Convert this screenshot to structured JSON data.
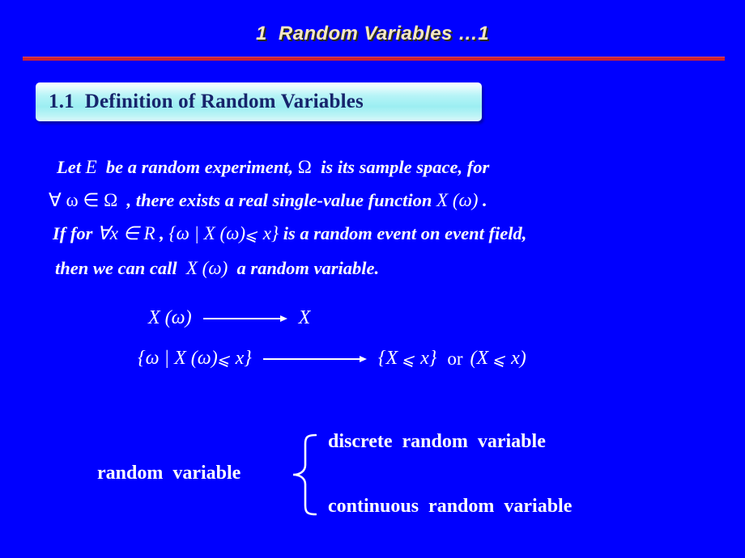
{
  "slide": {
    "title": "1  Random Variables …1",
    "heading": "1.1  Definition of Random Variables",
    "background_color": "#0000FF",
    "title_color": "#F6E7C4",
    "divider_color": "#CC2233",
    "heading_text_color": "#17246B",
    "body_text_color": "#FFFFFF"
  },
  "body": {
    "line1": {
      "part1": "Let ",
      "math1": "E",
      "part2": "  be a random experiment, ",
      "math2": "Ω",
      "part3": "  is its sample space, for"
    },
    "line2": {
      "math1": "∀ ω ∈ Ω",
      "part1": "  , there exists a real single-value function ",
      "math2": "X (ω)",
      "part2": " ."
    },
    "line3": {
      "part1": "If for ",
      "math1": "∀x ∈ R",
      "part2": " , ",
      "math2a": "{ω | X (ω)",
      "le": "⩽",
      "math2b": " x}",
      "part3": " is a random event on event field,"
    },
    "line4": {
      "part1": "then we can call  ",
      "math1": "X (ω)",
      "part2": "  a random variable."
    }
  },
  "mappings": [
    {
      "id": "mapping-1",
      "left": "X (ω)",
      "arrow": "⟶",
      "right": "X"
    },
    {
      "id": "mapping-2",
      "left_a": "{ω | X (ω)",
      "left_le": "⩽",
      "left_b": " x}",
      "arrow": "⟶",
      "right_a": "{X ",
      "right_le": "⩽",
      "right_b": " x}",
      "or": "or",
      "alt_a": "(X ",
      "alt_le": "⩽",
      "alt_b": " x)"
    }
  ],
  "classification": {
    "root": "random  variable",
    "items": [
      "discrete  random  variable",
      "continuous  random  variable"
    ]
  }
}
